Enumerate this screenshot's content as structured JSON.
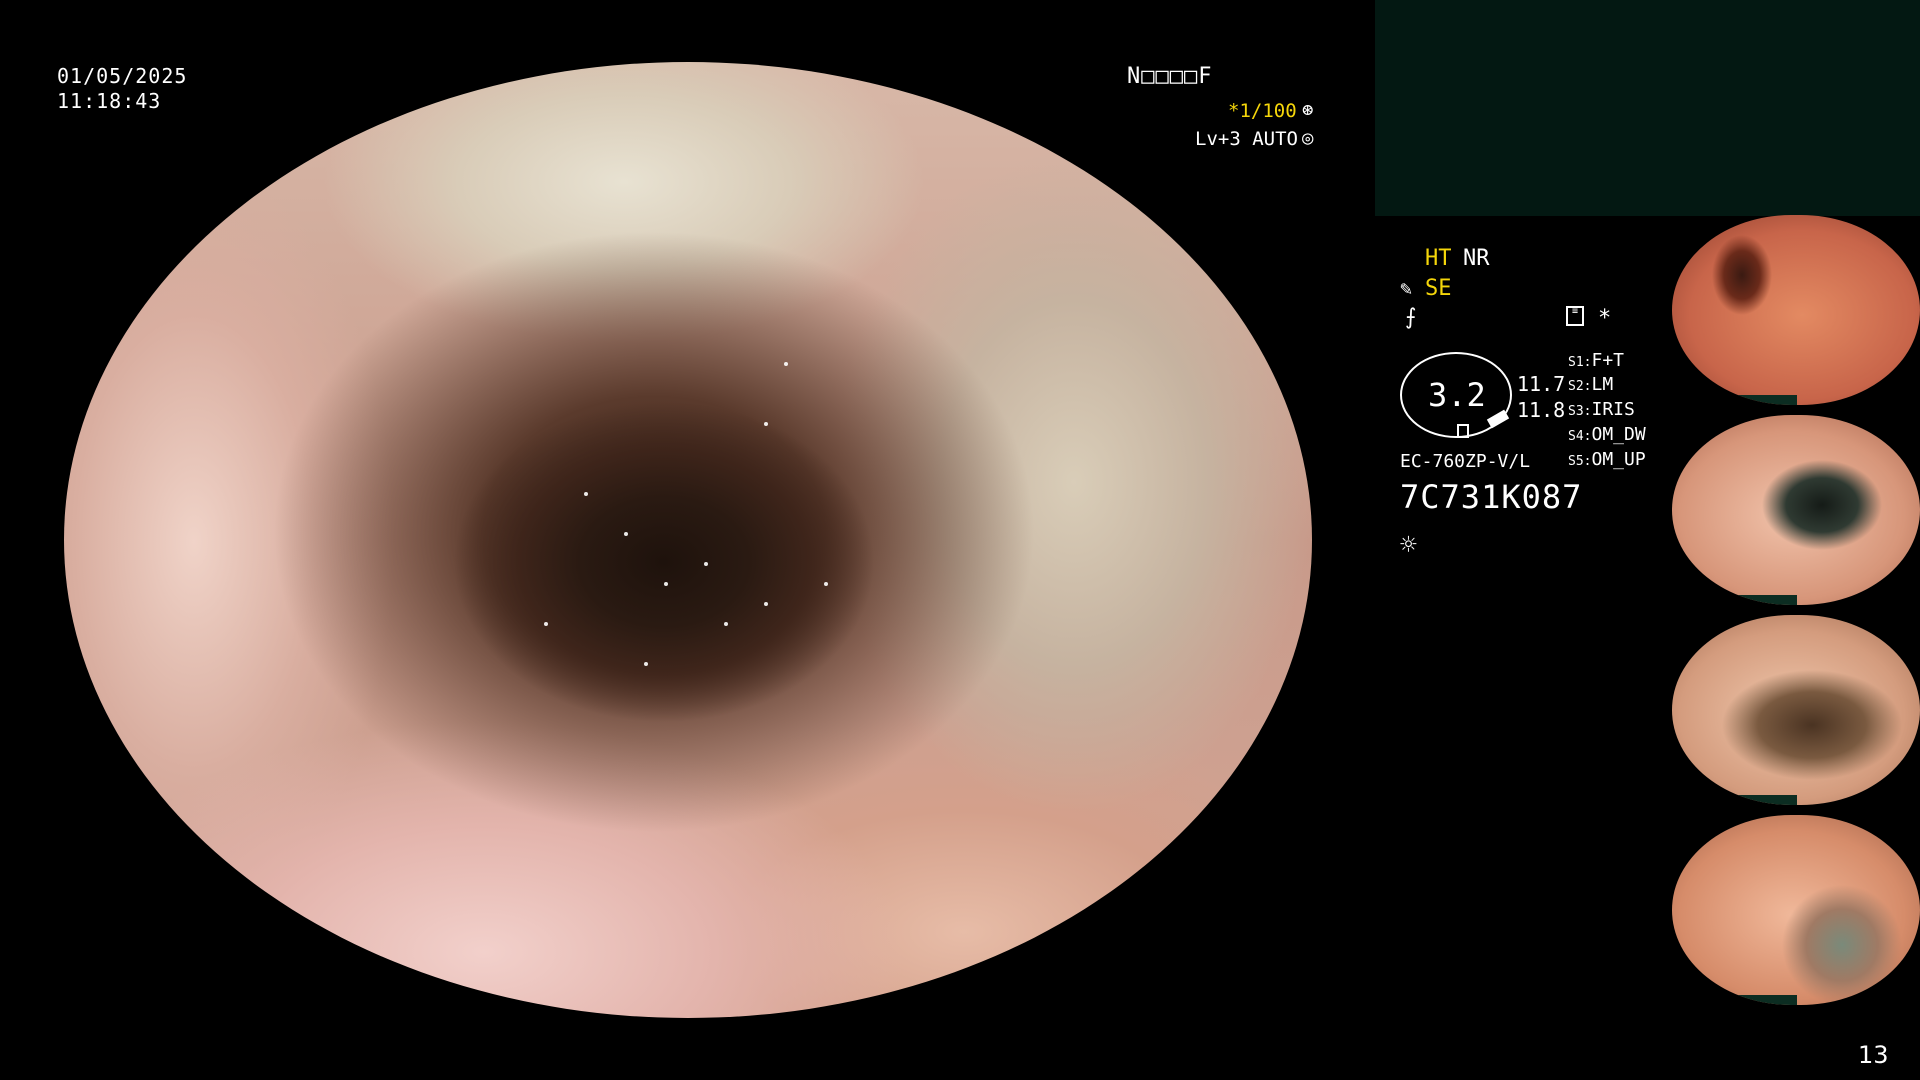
{
  "overlay": {
    "date": "01/05/2025",
    "time": "11:18:43",
    "mode": "N□□□□F",
    "shutter": "*1/100",
    "shutter_icon": "aperture-icon",
    "level": "Lv+3 AUTO",
    "level_icon": "auto-exposure-icon"
  },
  "settings": {
    "ht": "HT",
    "nr": "NR",
    "se": "SE",
    "se_icon": "pen-icon",
    "f_icon": "fog-icon",
    "star": "*",
    "gauge_value": "3.2",
    "value_1": "11.7",
    "value_2": "11.8",
    "scope_model": "EC-760ZP-V/L",
    "serial": "7C731K087",
    "light_icon": "light-icon",
    "s_keys": [
      {
        "key": "S1:",
        "val": "F+T"
      },
      {
        "key": "S2:",
        "val": "LM"
      },
      {
        "key": "S3:",
        "val": "IRIS"
      },
      {
        "key": "S4:",
        "val": "OM_DW"
      },
      {
        "key": "S5:",
        "val": "OM_UP"
      }
    ]
  },
  "page_number": "13",
  "colors": {
    "highlight": "#f5d60a",
    "panel": "#031812",
    "text": "#ffffff"
  }
}
